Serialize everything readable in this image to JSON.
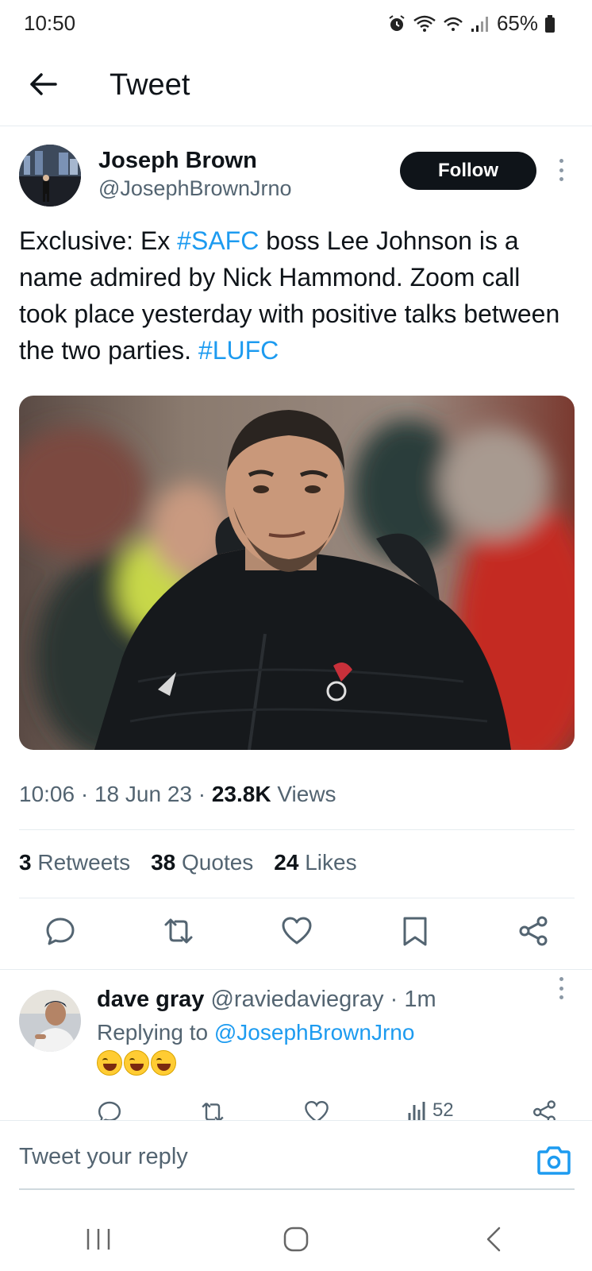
{
  "status_bar": {
    "time": "10:50",
    "battery": "65%"
  },
  "header": {
    "title": "Tweet"
  },
  "tweet": {
    "author_name": "Joseph Brown",
    "author_handle": "@JosephBrownJrno",
    "follow_label": "Follow",
    "text_parts": [
      "Exclusive: Ex ",
      "#SAFC",
      " boss Lee Johnson is a name admired by Nick Hammond. Zoom call took place yesterday with positive talks between the two parties. ",
      "#LUFC"
    ],
    "time": "10:06",
    "date": "18 Jun 23",
    "views_count": "23.8K",
    "views_label": "Views",
    "stats": [
      {
        "count": "3",
        "label": "Retweets"
      },
      {
        "count": "38",
        "label": "Quotes"
      },
      {
        "count": "24",
        "label": "Likes"
      }
    ]
  },
  "reply": {
    "name": "dave gray",
    "handle": "@raviedaviegray",
    "age": "1m",
    "replying_prefix": "Replying to",
    "replying_to": "@JosephBrownJrno",
    "views": "52"
  },
  "compose": {
    "placeholder": "Tweet your reply"
  },
  "colors": {
    "accent": "#1d9bf0",
    "text": "#0f1419",
    "muted": "#536471"
  },
  "icons": [
    "back-arrow-icon",
    "more-icon",
    "reply-icon",
    "retweet-icon",
    "like-icon",
    "bookmark-icon",
    "share-icon",
    "views-icon",
    "camera-icon"
  ]
}
